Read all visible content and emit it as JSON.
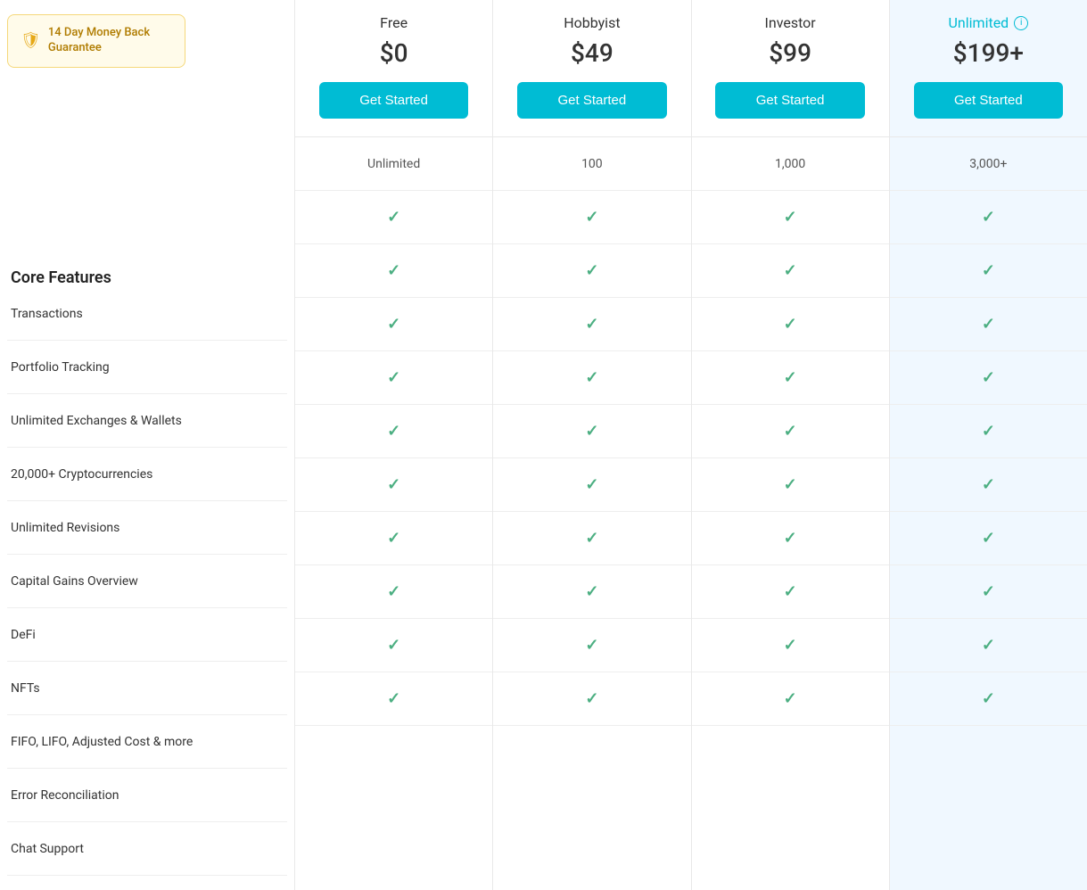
{
  "badge": {
    "text": "14 Day Money Back Guarantee"
  },
  "coreFeatures": {
    "title": "Core Features"
  },
  "features": [
    {
      "label": "Transactions"
    },
    {
      "label": "Portfolio Tracking"
    },
    {
      "label": "Unlimited Exchanges & Wallets"
    },
    {
      "label": "20,000+ Cryptocurrencies"
    },
    {
      "label": "Unlimited Revisions"
    },
    {
      "label": "Capital Gains Overview"
    },
    {
      "label": "DeFi"
    },
    {
      "label": "NFTs"
    },
    {
      "label": "FIFO, LIFO, Adjusted Cost & more"
    },
    {
      "label": "Error Reconciliation"
    },
    {
      "label": "Chat Support"
    }
  ],
  "plans": [
    {
      "id": "free",
      "name": "Free",
      "price": "$0",
      "buttonLabel": "Get Started",
      "isUnlimited": false,
      "transactions": "Unlimited",
      "checks": [
        true,
        true,
        true,
        true,
        true,
        true,
        true,
        true,
        true,
        true
      ]
    },
    {
      "id": "hobbyist",
      "name": "Hobbyist",
      "price": "$49",
      "buttonLabel": "Get Started",
      "isUnlimited": false,
      "transactions": "100",
      "checks": [
        true,
        true,
        true,
        true,
        true,
        true,
        true,
        true,
        true,
        true
      ]
    },
    {
      "id": "investor",
      "name": "Investor",
      "price": "$99",
      "buttonLabel": "Get Started",
      "isUnlimited": false,
      "transactions": "1,000",
      "checks": [
        true,
        true,
        true,
        true,
        true,
        true,
        true,
        true,
        true,
        true
      ]
    },
    {
      "id": "unlimited",
      "name": "Unlimited",
      "price": "$199+",
      "buttonLabel": "Get Started",
      "isUnlimited": true,
      "transactions": "3,000+",
      "checks": [
        true,
        true,
        true,
        true,
        true,
        true,
        true,
        true,
        true,
        true
      ]
    }
  ]
}
